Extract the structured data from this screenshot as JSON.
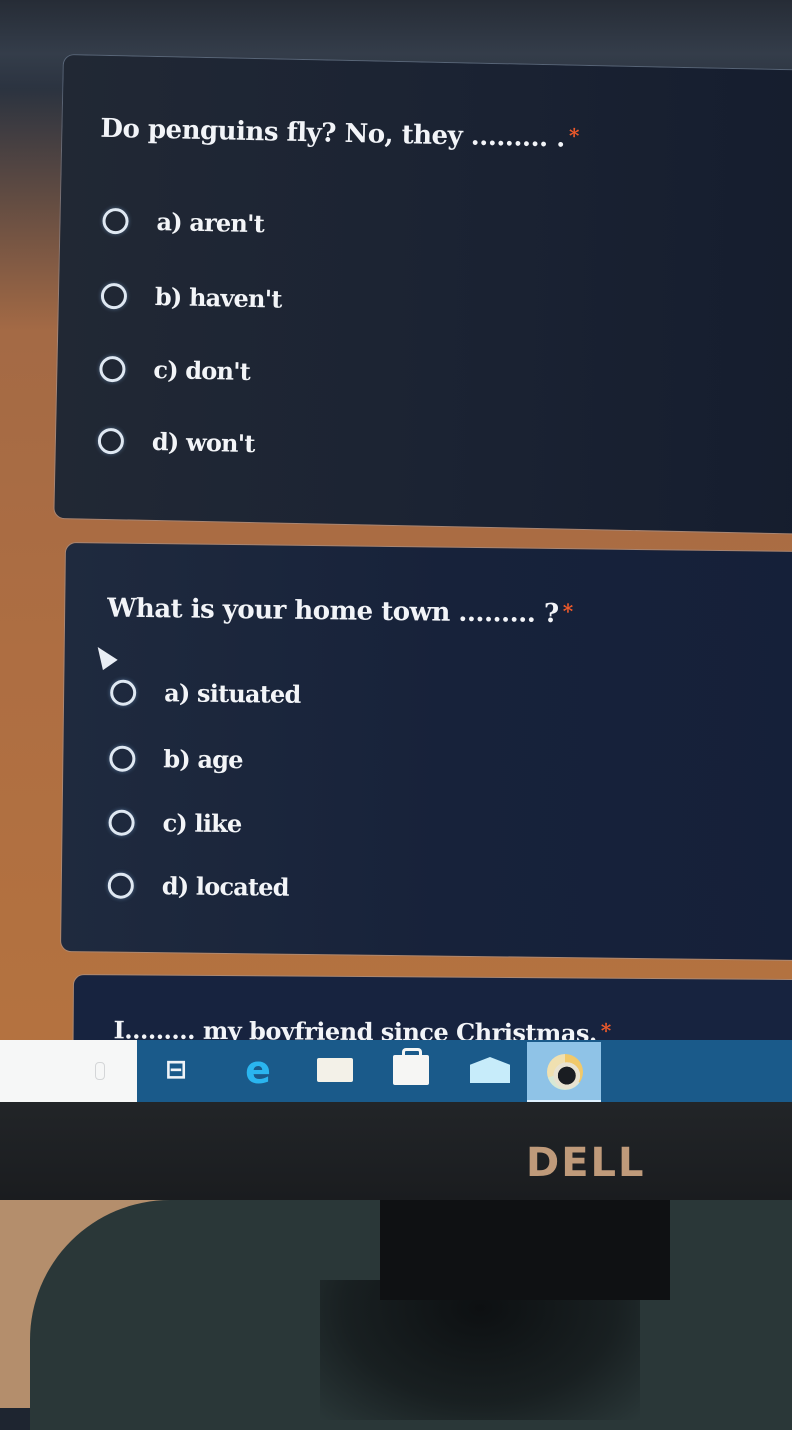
{
  "form": {
    "required_marker": "*",
    "questions": [
      {
        "title": "Do penguins fly? No, they ......... .",
        "options": [
          "a) aren't",
          "b) haven't",
          "c) don't",
          "d) won't"
        ]
      },
      {
        "title": "What is your home town ......... ?",
        "options": [
          "a) situated",
          "b) age",
          "c) like",
          "d) located"
        ]
      },
      {
        "title": "I......... my boyfriend since Christmas.",
        "options": []
      }
    ]
  },
  "taskbar": {
    "icons": [
      "search-box",
      "task-view-icon",
      "edge-icon",
      "file-explorer-icon",
      "store-icon",
      "mail-icon",
      "chrome-icon"
    ],
    "task_view_glyph": "⊟",
    "edge_glyph": "e",
    "active_app": "chrome"
  },
  "monitor": {
    "brand": "DELL"
  },
  "colors": {
    "background": "#ae6e42",
    "card": "#17223a",
    "required": "#f05a2a",
    "taskbar": "#1a5a8a"
  }
}
